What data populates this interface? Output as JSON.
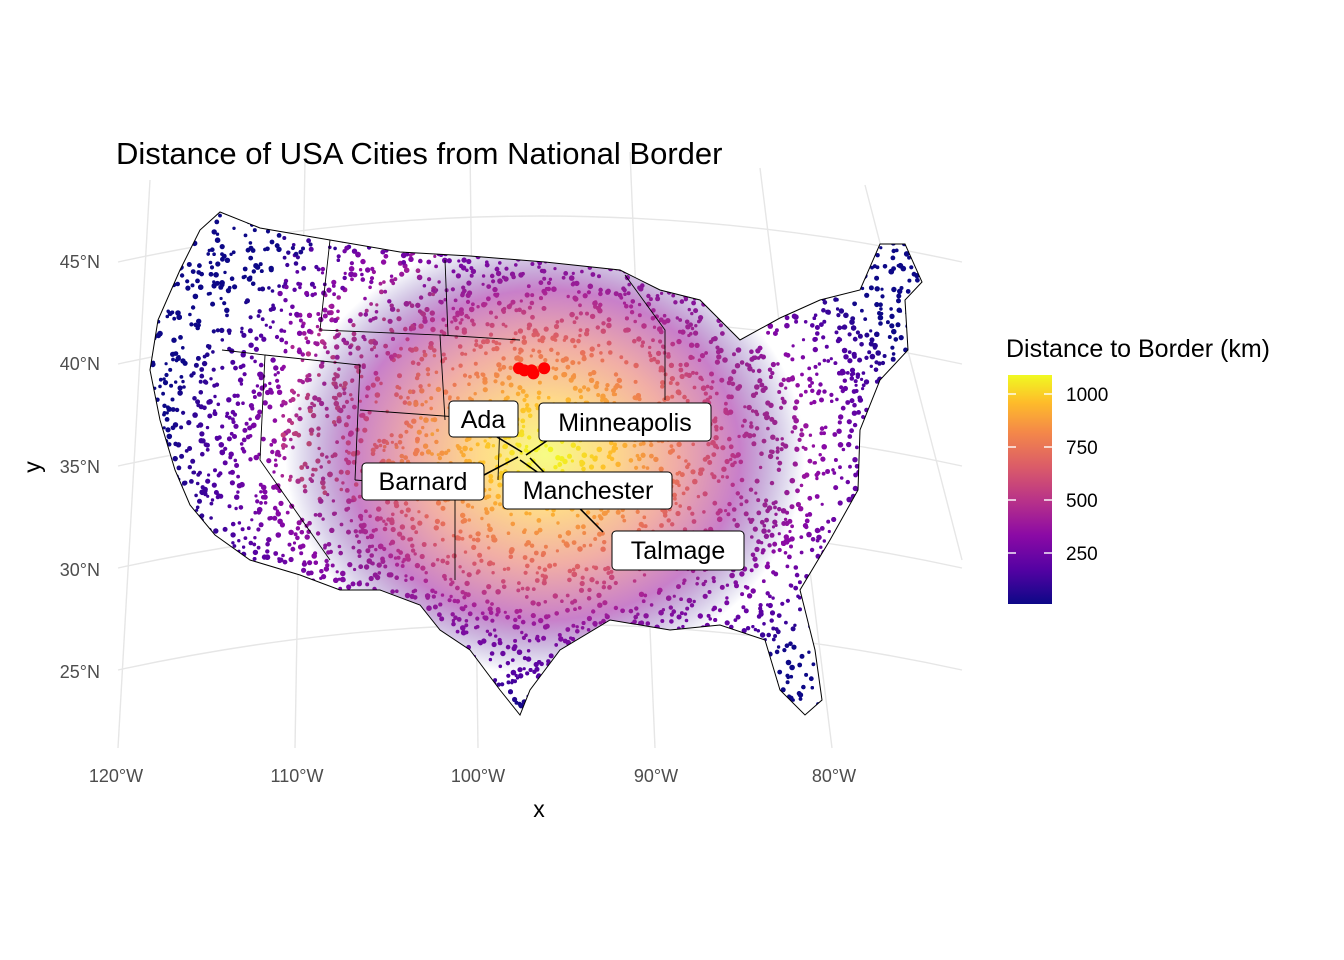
{
  "chart_data": {
    "type": "map-scatter",
    "title": "Distance of USA Cities from National Border",
    "xlabel": "x",
    "ylabel": "y",
    "x_ticks": [
      "120°W",
      "110°W",
      "100°W",
      "90°W",
      "80°W"
    ],
    "y_ticks": [
      "45°N",
      "40°N",
      "35°N",
      "30°N",
      "25°N"
    ],
    "legend": {
      "title": "Distance to Border (km)",
      "ticks": [
        "1000",
        "750",
        "500",
        "250"
      ],
      "tick_values": [
        1000,
        750,
        500,
        250
      ],
      "range": [
        0,
        1100
      ],
      "palette": "plasma",
      "placement": "right"
    },
    "highlight_color": "#ff0000",
    "highlighted_cities": [
      {
        "name": "Ada",
        "lon": -96.6,
        "lat": 39.2
      },
      {
        "name": "Minneapolis",
        "lon": -97.7,
        "lat": 39.1
      },
      {
        "name": "Barnard",
        "lon": -98.0,
        "lat": 39.2
      },
      {
        "name": "Manchester",
        "lon": -97.3,
        "lat": 39.1
      },
      {
        "name": "Talmage",
        "lon": -97.2,
        "lat": 38.95
      }
    ],
    "point_layer": "city points colored by distance to national border (km)",
    "grid": true
  }
}
